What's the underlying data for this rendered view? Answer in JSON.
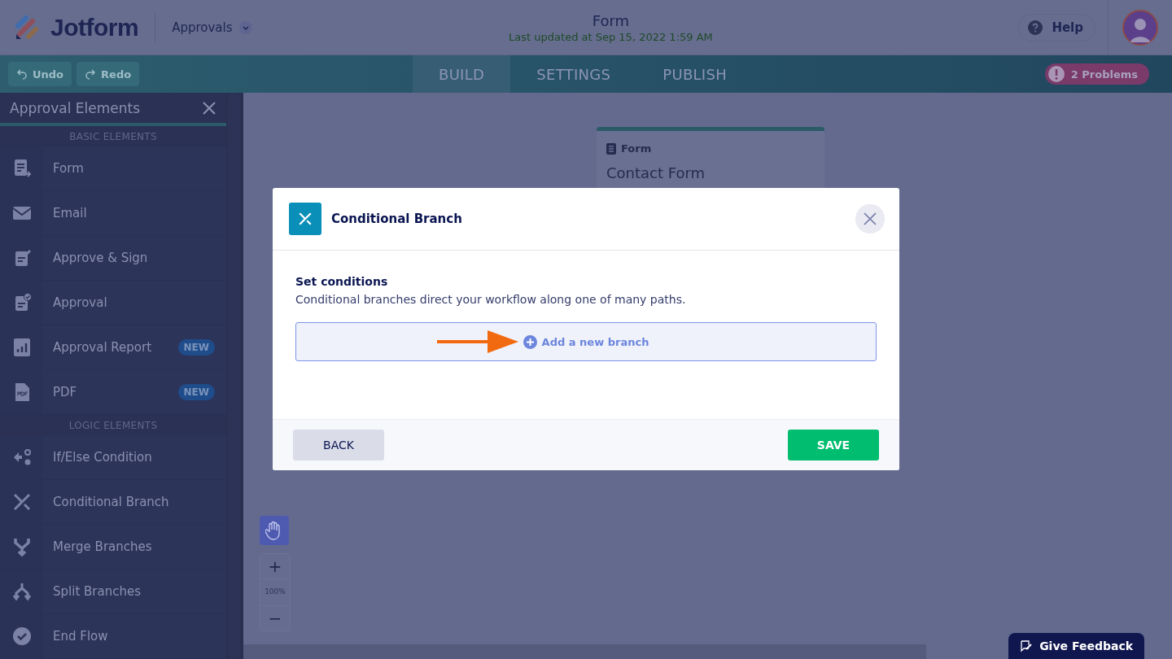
{
  "header": {
    "logo": "Jotform",
    "app_menu": "Approvals",
    "title": "Form",
    "subtitle": "Last updated at Sep 15, 2022 1:59 AM",
    "help": "Help"
  },
  "toolbar": {
    "undo": {
      "label": "Undo",
      "disabled": true
    },
    "redo": {
      "label": "Redo",
      "disabled": true
    },
    "tabs": [
      {
        "label": "BUILD",
        "selected": true
      },
      {
        "label": "SETTINGS",
        "selected": false
      },
      {
        "label": "PUBLISH",
        "selected": false
      }
    ],
    "problems": "2 Problems"
  },
  "sidebar": {
    "title": "Approval Elements",
    "sections": [
      {
        "title": "BASIC ELEMENTS",
        "items": [
          {
            "label": "Form"
          },
          {
            "label": "Email"
          },
          {
            "label": "Approve & Sign"
          },
          {
            "label": "Approval"
          },
          {
            "label": "Approval Report",
            "badge": "NEW"
          },
          {
            "label": "PDF",
            "badge": "NEW"
          }
        ]
      },
      {
        "title": "LOGIC ELEMENTS",
        "items": [
          {
            "label": "If/Else Condition"
          },
          {
            "label": "Conditional Branch"
          },
          {
            "label": "Merge Branches"
          },
          {
            "label": "Split Branches"
          },
          {
            "label": "End Flow"
          }
        ]
      }
    ]
  },
  "canvas": {
    "node": {
      "type": "Form",
      "title": "Contact Form"
    },
    "zoom": {
      "plus": "+",
      "level": "100%",
      "minus": "−"
    }
  },
  "modal": {
    "title": "Conditional Branch",
    "heading": "Set conditions",
    "description": "Conditional branches direct your workflow along one of many paths.",
    "add_button": "Add a new branch",
    "back": "BACK",
    "save": "SAVE"
  },
  "feedback": "Give Feedback"
}
